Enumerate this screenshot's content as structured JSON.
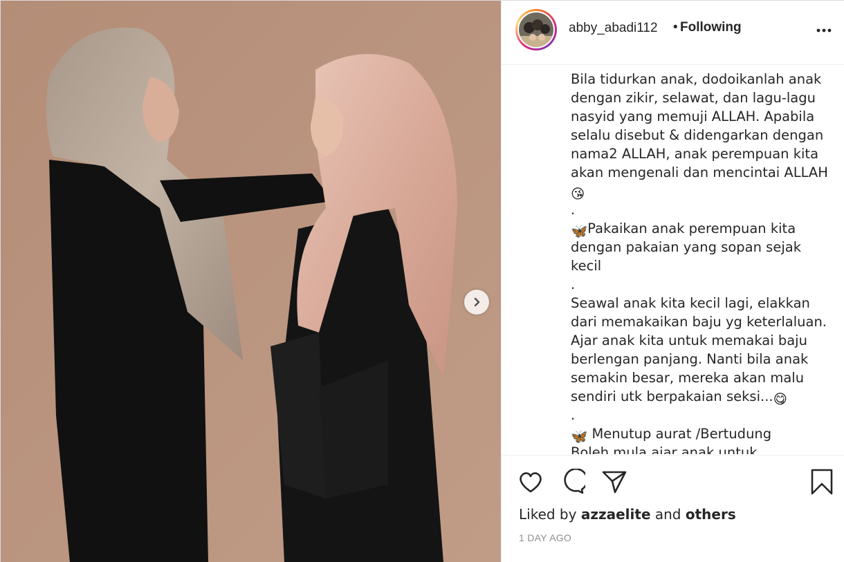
{
  "post": {
    "author": {
      "username": "abby_abadi112",
      "separator": "•",
      "follow_status": "Following"
    },
    "caption_lines": [
      {
        "text": "Bila tidurkan anak, dodoikanlah anak",
        "emoji": ""
      },
      {
        "text": "dengan zikir, selawat, dan lagu-lagu",
        "emoji": ""
      },
      {
        "text": "nasyid yang memuji ALLAH. Apabila",
        "emoji": ""
      },
      {
        "text": "selalu disebut & didengarkan dengan",
        "emoji": ""
      },
      {
        "text": "nama2 ALLAH, anak perempuan kita",
        "emoji": ""
      },
      {
        "text": "akan mengenali dan mencintai ALLAH",
        "emoji": ""
      },
      {
        "text": "",
        "emoji": "😘"
      },
      {
        "text": ".",
        "emoji": ""
      },
      {
        "text": "Pakaikan anak perempuan kita",
        "emoji": "🦋",
        "emoji_first": true
      },
      {
        "text": "dengan pakaian yang sopan sejak",
        "emoji": ""
      },
      {
        "text": "kecil",
        "emoji": ""
      },
      {
        "text": ".",
        "emoji": ""
      },
      {
        "text": "Seawal anak kita kecil lagi, elakkan",
        "emoji": ""
      },
      {
        "text": "dari memakaikan baju yg keterlaluan.",
        "emoji": ""
      },
      {
        "text": "Ajar anak kita untuk memakai baju",
        "emoji": ""
      },
      {
        "text": "berlengan panjang. Nanti bila anak",
        "emoji": ""
      },
      {
        "text": "semakin besar, mereka akan malu",
        "emoji": ""
      },
      {
        "text": "sendiri utk berpakaian seksi...",
        "emoji": "😋"
      },
      {
        "text": ".",
        "emoji": ""
      },
      {
        "text": " Menutup aurat /Bertudung",
        "emoji": "🦋",
        "emoji_first": true
      },
      {
        "text": "Boleh mula ajar anak untuk bertudung",
        "emoji": ""
      }
    ],
    "likes": {
      "prefix": "Liked by",
      "first_user": "azzaelite",
      "joiner": "and",
      "others": "others"
    },
    "timestamp": "1 DAY AGO",
    "icons": {
      "like": "heart-icon",
      "comment": "comment-icon",
      "share": "paper-plane-icon",
      "save": "bookmark-icon",
      "more": "more-icon",
      "next": "chevron-right-icon"
    },
    "colors": {
      "background_photo": "#b8937e",
      "text": "#262626",
      "muted": "#8e8e8e",
      "divider": "#efefef"
    }
  }
}
